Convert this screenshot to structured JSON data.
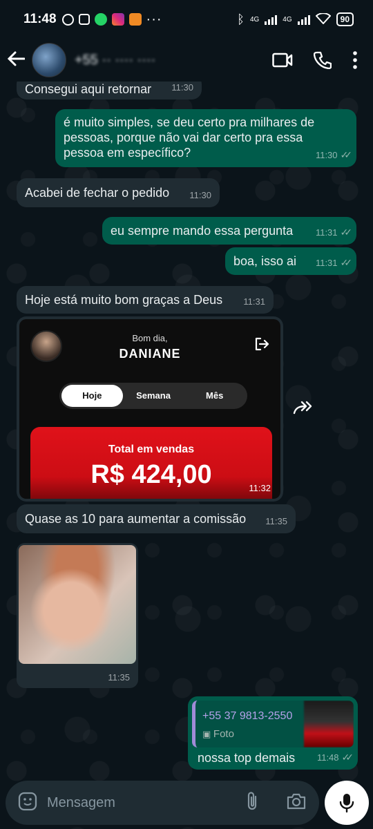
{
  "status_bar": {
    "time": "11:48",
    "network_left": "4G",
    "network_right": "4G",
    "battery": "90"
  },
  "header": {
    "contact_name": "+55 ·· ···· ····",
    "icons": [
      "back-arrow-icon",
      "video-call-icon",
      "phone-call-icon",
      "more-vert-icon"
    ]
  },
  "messages": [
    {
      "dir": "in",
      "text": "Consegui aqui retornar",
      "time": "11:30"
    },
    {
      "dir": "out",
      "text": "é muito simples, se deu certo pra milhares de pessoas, porque não vai dar certo pra essa pessoa em específico?",
      "time": "11:30"
    },
    {
      "dir": "in",
      "text": "Acabei de fechar o pedido",
      "time": "11:30"
    },
    {
      "dir": "out",
      "text": "eu sempre mando essa pergunta",
      "time": "11:31"
    },
    {
      "dir": "out",
      "text": "boa, isso ai",
      "time": "11:31"
    },
    {
      "dir": "in",
      "text": "Hoje está muito bom graças a Deus",
      "time": "11:31"
    },
    {
      "dir": "in",
      "text": "Quase as 10 para aumentar a comissão",
      "time": "11:35"
    }
  ],
  "screenshot_card": {
    "greeting": "Bom dia,",
    "user_name": "DANIANE",
    "tabs": [
      "Hoje",
      "Semana",
      "Mês"
    ],
    "active_tab": "Hoje",
    "sales_label": "Total em vendas",
    "sales_amount": "R$ 424,00",
    "time": "11:32"
  },
  "photo_message": {
    "time": "11:35"
  },
  "reply_message": {
    "quoted_sender": "+55 37 9813-2550",
    "quoted_type": "Foto",
    "text": "nossa top demais",
    "time": "11:48"
  },
  "composer": {
    "placeholder": "Mensagem"
  },
  "colors": {
    "background": "#0b141a",
    "incoming": "#202c33",
    "outgoing": "#005c4b",
    "accent_red": "#e0121a"
  }
}
